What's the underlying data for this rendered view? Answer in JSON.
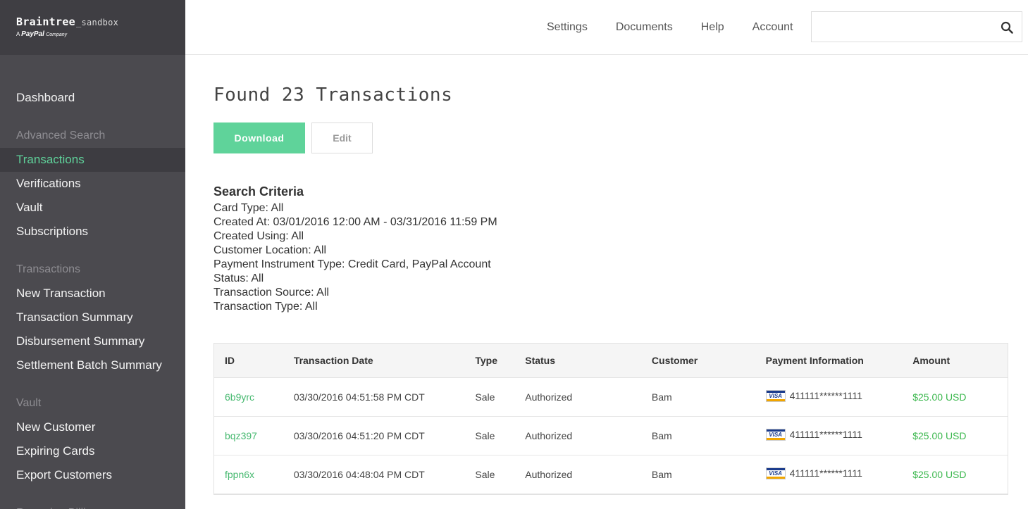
{
  "logo": {
    "name": "Braintree",
    "env": "_sandbox",
    "tagline_prefix": "A",
    "tagline_brand": "PayPal",
    "tagline_suffix": "Company"
  },
  "sidebar": {
    "dashboard": "Dashboard",
    "sections": [
      {
        "header": "Advanced Search",
        "items": [
          "Transactions",
          "Verifications",
          "Vault",
          "Subscriptions"
        ]
      },
      {
        "header": "Transactions",
        "items": [
          "New Transaction",
          "Transaction Summary",
          "Disbursement Summary",
          "Settlement Batch Summary"
        ]
      },
      {
        "header": "Vault",
        "items": [
          "New Customer",
          "Expiring Cards",
          "Export Customers"
        ]
      },
      {
        "header": "Recurring Billing",
        "items": []
      }
    ],
    "active": "Transactions"
  },
  "topnav": {
    "settings": "Settings",
    "documents": "Documents",
    "help": "Help",
    "account": "Account"
  },
  "search": {
    "value": "",
    "placeholder": ""
  },
  "main": {
    "title": "Found 23 Transactions",
    "download_label": "Download",
    "edit_label": "Edit",
    "criteria_title": "Search Criteria",
    "criteria": [
      "Card Type: All",
      "Created At: 03/01/2016 12:00 AM - 03/31/2016 11:59 PM",
      "Created Using: All",
      "Customer Location: All",
      "Payment Instrument Type: Credit Card, PayPal Account",
      "Status: All",
      "Transaction Source: All",
      "Transaction Type: All"
    ]
  },
  "table": {
    "headers": [
      "ID",
      "Transaction Date",
      "Type",
      "Status",
      "Customer",
      "Payment Information",
      "Amount"
    ],
    "rows": [
      {
        "id": "6b9yrc",
        "date": "03/30/2016 04:51:58 PM CDT",
        "type": "Sale",
        "status": "Authorized",
        "customer": "Bam",
        "card_brand": "VISA",
        "card": "411111******1111",
        "amount": "$25.00 USD"
      },
      {
        "id": "bqz397",
        "date": "03/30/2016 04:51:20 PM CDT",
        "type": "Sale",
        "status": "Authorized",
        "customer": "Bam",
        "card_brand": "VISA",
        "card": "411111******1111",
        "amount": "$25.00 USD"
      },
      {
        "id": "fppn6x",
        "date": "03/30/2016 04:48:04 PM CDT",
        "type": "Sale",
        "status": "Authorized",
        "customer": "Bam",
        "card_brand": "VISA",
        "card": "411111******1111",
        "amount": "$25.00 USD"
      }
    ]
  },
  "colors": {
    "sidebar_bg": "#4b4a4f",
    "accent_green": "#5fd39a",
    "link_green": "#47b970",
    "amount_green": "#3db84f"
  },
  "icons": {
    "search": "search-icon",
    "card": "visa-card-icon"
  }
}
